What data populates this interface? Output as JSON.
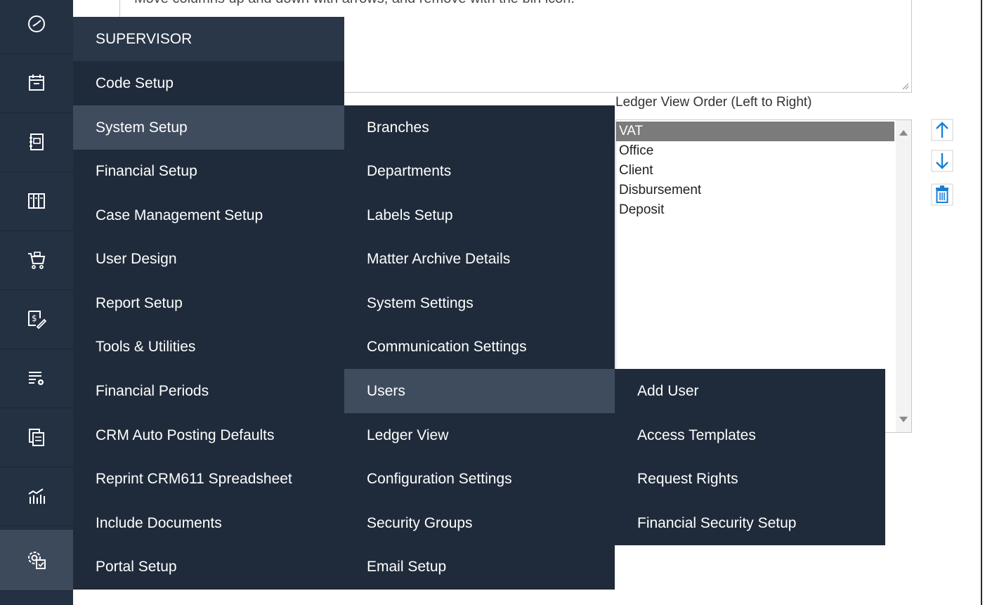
{
  "textarea": {
    "partial_text": "Move columns up and down with arrows, and remove with the bin icon."
  },
  "ledger": {
    "label": "Ledger View Order (Left to Right)",
    "items": [
      "VAT",
      "Office",
      "Client",
      "Disbursement",
      "Deposit"
    ],
    "selected": "VAT"
  },
  "rail": {
    "icons": [
      "dashboard-icon",
      "calendar-icon",
      "contacts-book-icon",
      "library-icon",
      "cart-icon",
      "billing-icon",
      "list-settings-icon",
      "documents-icon",
      "reports-chart-icon",
      "supervisor-settings-icon"
    ],
    "active": "supervisor-settings-icon"
  },
  "menu1": {
    "header": "SUPERVISOR",
    "items": [
      "Code Setup",
      "System Setup",
      "Financial Setup",
      "Case Management Setup",
      "User Design",
      "Report Setup",
      "Tools & Utilities",
      "Financial Periods",
      "CRM Auto Posting Defaults",
      "Reprint CRM611 Spreadsheet",
      "Include Documents",
      "Portal Setup"
    ],
    "highlighted": "System Setup"
  },
  "menu2": {
    "items": [
      "Branches",
      "Departments",
      "Labels Setup",
      "Matter Archive Details",
      "System Settings",
      "Communication Settings",
      "Users",
      "Ledger View",
      "Configuration Settings",
      "Security Groups",
      "Email Setup"
    ],
    "highlighted": "Users"
  },
  "menu3": {
    "items": [
      "Add User",
      "Access Templates",
      "Request Rights",
      "Financial Security Setup"
    ]
  },
  "colors": {
    "rail": "#243143",
    "menu": "#1f2b3a",
    "highlight": "#3f4c5d",
    "accent": "#1a7fd4"
  }
}
